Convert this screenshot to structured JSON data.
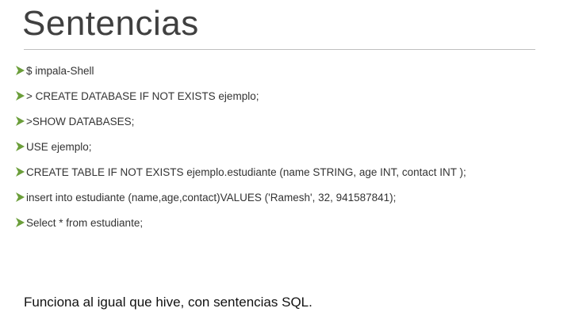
{
  "slide": {
    "title": "Sentencias",
    "bullets": [
      "$ impala-Shell",
      "> CREATE DATABASE IF NOT EXISTS ejemplo;",
      ">SHOW DATABASES;",
      "USE ejemplo;",
      "CREATE TABLE IF NOT EXISTS ejemplo.estudiante (name STRING, age INT, contact INT );",
      "insert into estudiante (name,age,contact)VALUES ('Ramesh', 32, 941587841);",
      "Select * from estudiante;"
    ],
    "bullet_icon": "arrowhead-bullet-icon",
    "bullet_color": "#6b9e3a",
    "footer": "Funciona al igual que hive, con sentencias SQL."
  }
}
